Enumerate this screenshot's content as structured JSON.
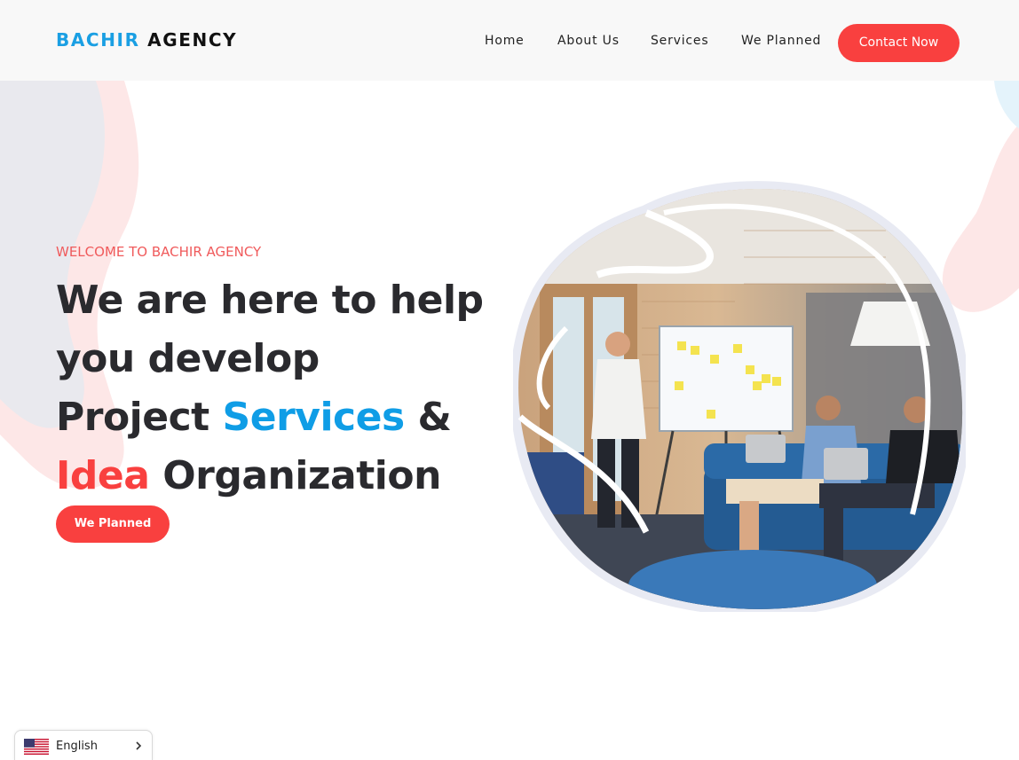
{
  "header": {
    "logo": {
      "part1": "BACHIR",
      "part2": "AGENCY"
    },
    "nav": [
      "Home",
      "About Us",
      "Services",
      "We Planned"
    ],
    "cta_label": "Contact Now"
  },
  "hero": {
    "welcome": "WELCOME TO BACHIR AGENCY",
    "headline": {
      "line1": "We are here to help",
      "line2": "you develop",
      "line3_a": "Project",
      "line3_b": "Services",
      "line3_c": "&",
      "line4_a": "Idea",
      "line4_b": "Organization"
    },
    "button_label": "We Planned",
    "image_icon": "team-meeting-photo"
  },
  "language_selector": {
    "selected": "English",
    "flag_icon": "us-flag-icon",
    "chevron_icon": "chevron-right-icon"
  },
  "colors": {
    "brand_blue": "#1a9fe3",
    "accent_red": "#f9403f",
    "text_dark": "#2a2a2e",
    "welcome_red": "#f05a5b"
  }
}
